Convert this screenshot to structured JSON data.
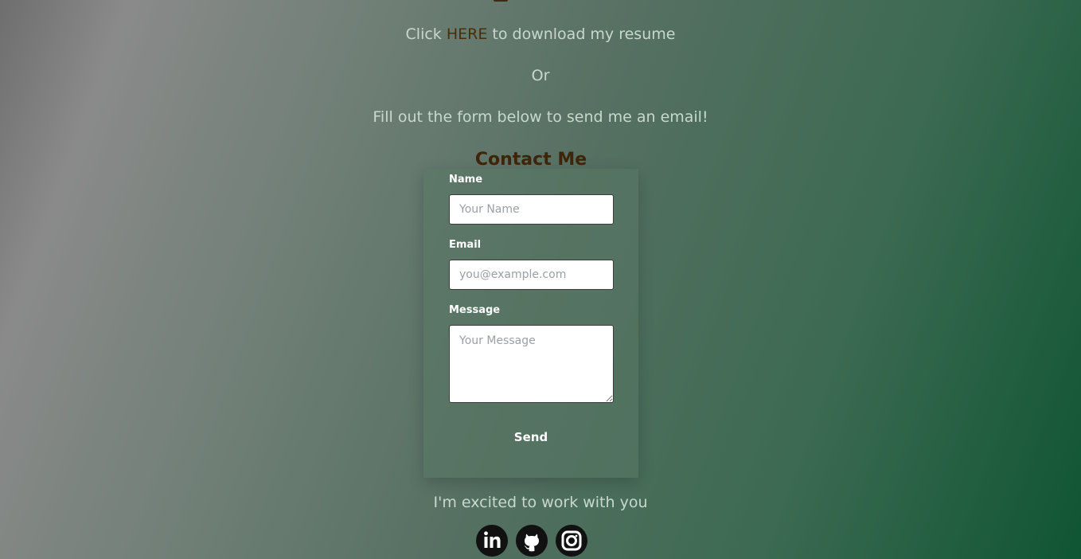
{
  "intro": {
    "resume_prefix": "Click ",
    "resume_link": "HERE",
    "resume_suffix": " to download my resume",
    "or_text": "Or",
    "form_prompt": "Fill out the form below to send me an email!"
  },
  "contact": {
    "title": "Contact Me",
    "name_label": "Name",
    "name_placeholder": "Your Name",
    "email_label": "Email",
    "email_placeholder": "you@example.com",
    "message_label": "Message",
    "message_placeholder": "Your Message",
    "send_label": "Send"
  },
  "footer": {
    "tagline": "I'm excited to work with you",
    "socials": [
      {
        "icon": "linkedin-icon"
      },
      {
        "icon": "github-icon"
      },
      {
        "icon": "instagram-icon"
      }
    ]
  },
  "colors": {
    "link": "#4a2e0a",
    "title": "#3e250a",
    "background_start": "#8a8a8a",
    "background_end": "#0f5533"
  }
}
